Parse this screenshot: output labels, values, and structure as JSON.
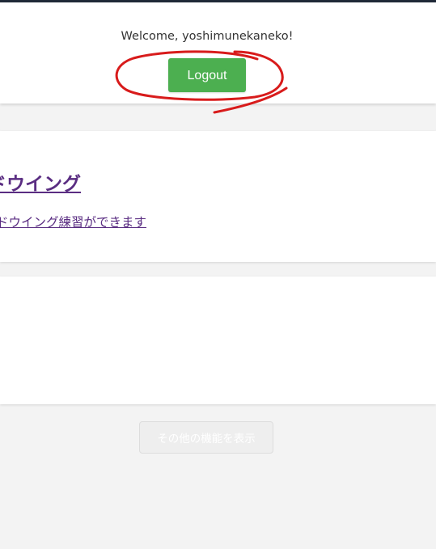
{
  "header": {
    "welcome_text": "Welcome, yoshimunekaneko!",
    "logout_label": "Logout"
  },
  "cards": [
    {
      "title": "ドウイング",
      "description": "ドウイング練習ができます"
    }
  ],
  "more_button_label": "その他の機能を表示",
  "colors": {
    "logout_button": "#4caf50",
    "link": "#5a2d82",
    "annotation_circle": "#d81b1b",
    "page_background": "#f3f3f3",
    "top_strip": "#1f2937"
  }
}
